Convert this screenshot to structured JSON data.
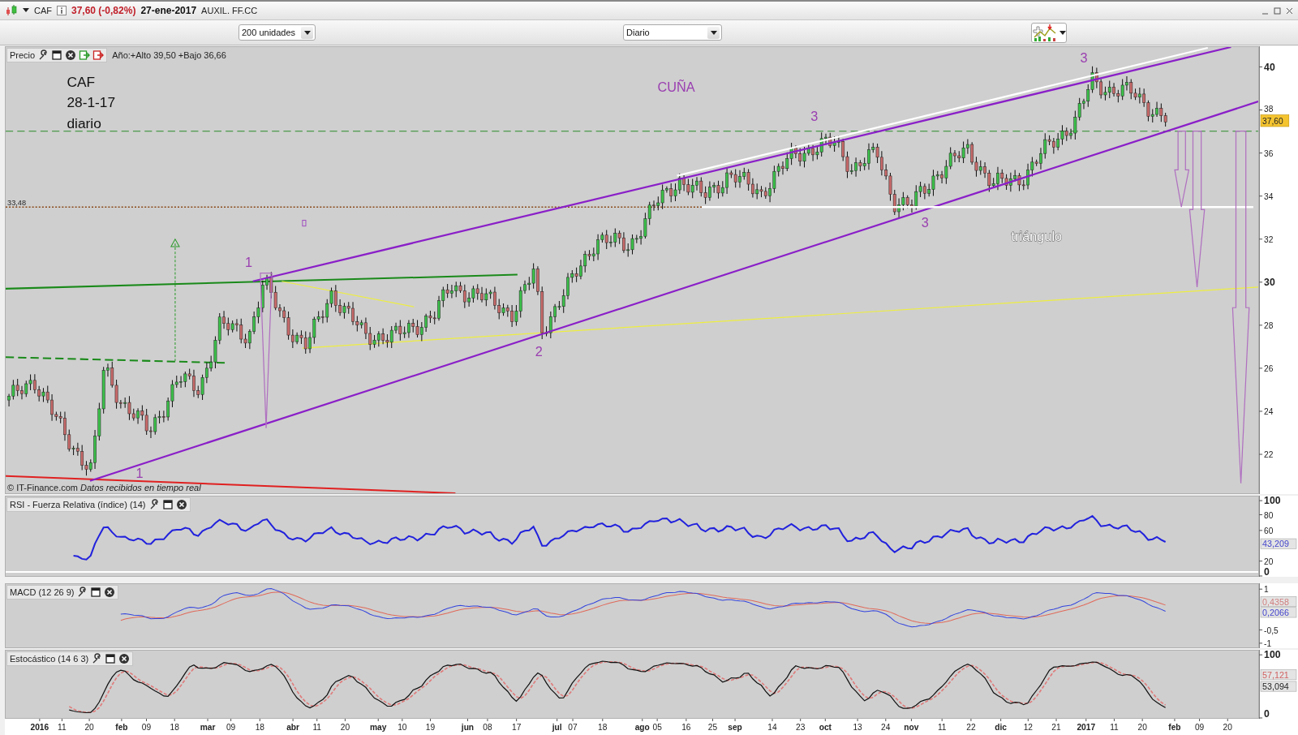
{
  "header": {
    "symbol": "CAF",
    "price_change": "37,60 (-0,82%)",
    "date": "27-ene-2017",
    "market": "AUXIL. FF.CC"
  },
  "toolbar": {
    "units": "200 unidades",
    "period": "Diario"
  },
  "price_panel": {
    "title": "Precio",
    "year_range": "Año:+Alto 39,50 +Bajo 36,66",
    "annotations": [
      {
        "text": "CAF",
        "kind": "note"
      },
      {
        "text": "28-1-17",
        "kind": "note"
      },
      {
        "text": "diario",
        "kind": "note"
      },
      {
        "text": "CUÑA",
        "kind": "pattern"
      },
      {
        "text": "triángulo",
        "kind": "highlight"
      }
    ],
    "wave_labels": [
      "3",
      "3",
      "3",
      "1",
      "2",
      "1"
    ],
    "level_label": "33,48",
    "last_price": "37,60",
    "credit": "© IT-Finance.com *Datos recibidos en tiempo real*",
    "y_ticks": [
      {
        "label": "40",
        "major": true
      },
      {
        "label": "38",
        "major": false
      },
      {
        "label": "36",
        "major": false
      },
      {
        "label": "34",
        "major": false
      },
      {
        "label": "32",
        "major": false
      },
      {
        "label": "30",
        "major": true
      },
      {
        "label": "28",
        "major": false
      },
      {
        "label": "26",
        "major": false
      },
      {
        "label": "24",
        "major": false
      },
      {
        "label": "22",
        "major": false
      }
    ]
  },
  "indicators": [
    {
      "kind": "rsi",
      "title": "RSI - Fuerza Relativa (índice) (14)",
      "y_ticks": [
        {
          "label": "100",
          "major": true
        },
        {
          "label": "80",
          "major": false
        },
        {
          "label": "60",
          "major": false
        },
        {
          "label": "20",
          "major": false
        },
        {
          "label": "0",
          "major": true
        }
      ],
      "readings": [
        {
          "text": "43,209",
          "color": "#4444cc"
        }
      ]
    },
    {
      "kind": "macd",
      "title": "MACD (12 26 9)",
      "y_ticks": [
        {
          "label": "1",
          "major": false
        },
        {
          "label": "-0,5",
          "major": false
        },
        {
          "label": "-1",
          "major": false
        }
      ],
      "readings": [
        {
          "text": "0,4358",
          "color": "#d08080"
        },
        {
          "text": "0,2066",
          "color": "#4444cc"
        }
      ]
    },
    {
      "kind": "stochastic",
      "title": "Estocástico (14 6 3)",
      "y_ticks": [
        {
          "label": "100",
          "major": true
        },
        {
          "label": "0",
          "major": true
        }
      ],
      "readings": [
        {
          "text": "57,121",
          "color": "#d06060"
        },
        {
          "text": "53,094",
          "color": "#222222"
        }
      ]
    }
  ],
  "x_axis": [
    {
      "label": "2016",
      "major": true
    },
    {
      "label": "11",
      "major": false
    },
    {
      "label": "20",
      "major": false
    },
    {
      "label": "feb",
      "major": true
    },
    {
      "label": "09",
      "major": false
    },
    {
      "label": "18",
      "major": false
    },
    {
      "label": "mar",
      "major": true
    },
    {
      "label": "09",
      "major": false
    },
    {
      "label": "18",
      "major": false
    },
    {
      "label": "abr",
      "major": true
    },
    {
      "label": "11",
      "major": false
    },
    {
      "label": "20",
      "major": false
    },
    {
      "label": "may",
      "major": true
    },
    {
      "label": "10",
      "major": false
    },
    {
      "label": "19",
      "major": false
    },
    {
      "label": "jun",
      "major": true
    },
    {
      "label": "08",
      "major": false
    },
    {
      "label": "17",
      "major": false
    },
    {
      "label": "jul",
      "major": true
    },
    {
      "label": "07",
      "major": false
    },
    {
      "label": "18",
      "major": false
    },
    {
      "label": "ago",
      "major": true
    },
    {
      "label": "05",
      "major": false
    },
    {
      "label": "16",
      "major": false
    },
    {
      "label": "25",
      "major": false
    },
    {
      "label": "sep",
      "major": true
    },
    {
      "label": "14",
      "major": false
    },
    {
      "label": "23",
      "major": false
    },
    {
      "label": "oct",
      "major": true
    },
    {
      "label": "13",
      "major": false
    },
    {
      "label": "24",
      "major": false
    },
    {
      "label": "nov",
      "major": true
    },
    {
      "label": "11",
      "major": false
    },
    {
      "label": "22",
      "major": false
    },
    {
      "label": "dic",
      "major": true
    },
    {
      "label": "12",
      "major": false
    },
    {
      "label": "21",
      "major": false
    },
    {
      "label": "2017",
      "major": true
    },
    {
      "label": "11",
      "major": false
    },
    {
      "label": "20",
      "major": false
    },
    {
      "label": "feb",
      "major": true
    },
    {
      "label": "09",
      "major": false
    },
    {
      "label": "20",
      "major": false
    }
  ]
}
